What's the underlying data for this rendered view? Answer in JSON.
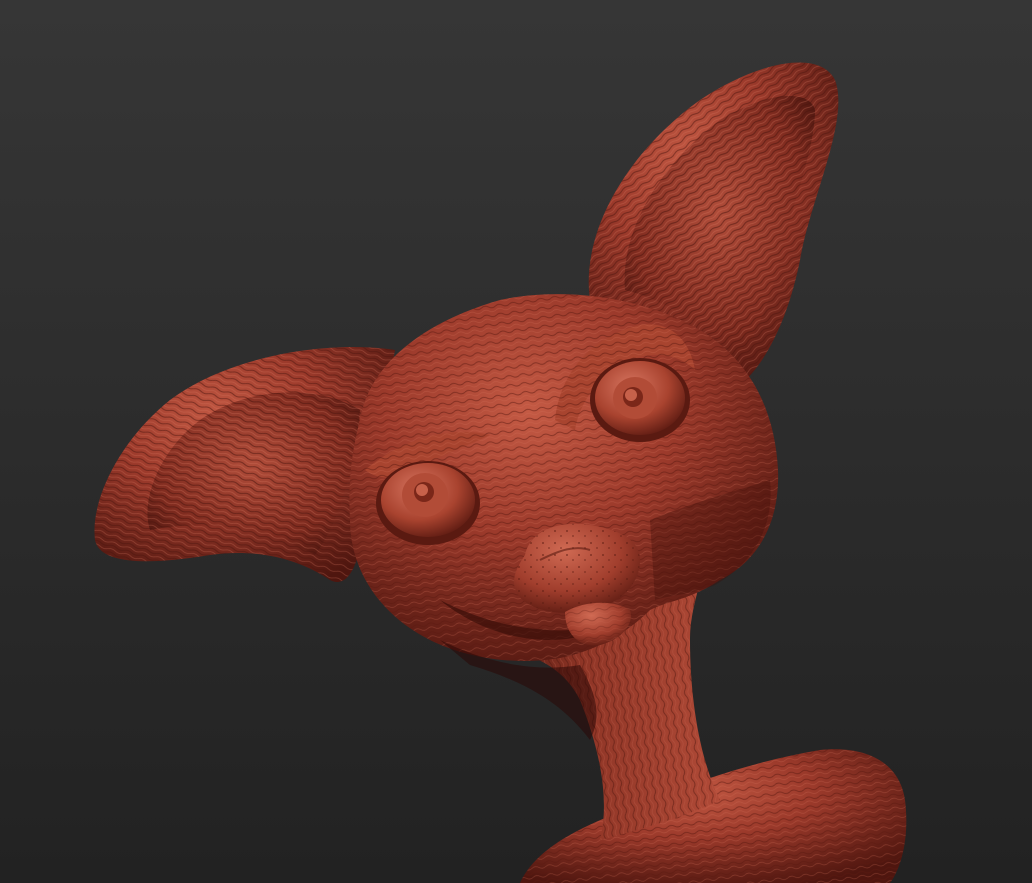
{
  "scene": {
    "subject": "sculpted-creature-bust",
    "material_color": "#9e3a2c",
    "material_highlight": "#c9654f",
    "material_shadow": "#4a140d",
    "background_top": "#353535",
    "background_bottom": "#222222"
  }
}
